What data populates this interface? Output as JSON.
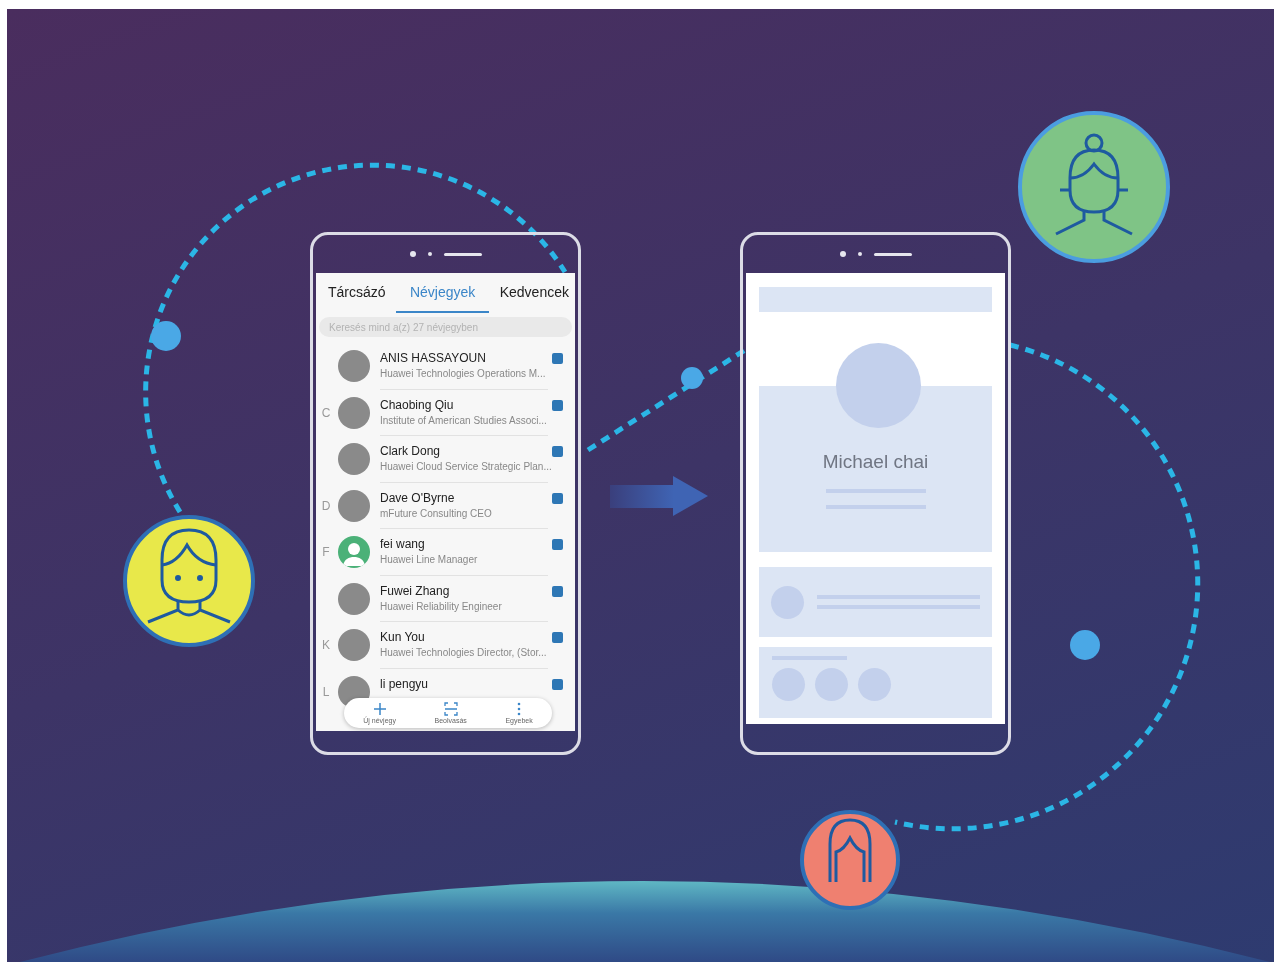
{
  "contacts_phone": {
    "tabs": [
      {
        "label": "Tárcsázó",
        "selected": false
      },
      {
        "label": "Névjegyek",
        "selected": true
      },
      {
        "label": "Kedvencek",
        "selected": false
      }
    ],
    "search": {
      "placeholder": "Keresés mind a(z) 27 névjegyben"
    },
    "contacts": [
      {
        "name": "ANIS HASSAYOUN",
        "subtitle": "Huawei Technologies Operations M...",
        "kind": "photo"
      },
      {
        "index_letter": "C",
        "name": "Chaobing Qiu",
        "subtitle": "Institute of American Studies Associ...",
        "kind": "photo"
      },
      {
        "name": "Clark Dong",
        "subtitle": "Huawei Cloud Service Strategic Plan...",
        "kind": "photo"
      },
      {
        "index_letter": "D",
        "name": "Dave O'Byrne",
        "subtitle": "mFuture Consulting CEO",
        "kind": "photo"
      },
      {
        "index_letter": "F",
        "name": "fei wang",
        "subtitle": "Huawei Line Manager",
        "kind": "silhouette"
      },
      {
        "name": "Fuwei Zhang",
        "subtitle": "Huawei Reliability Engineer",
        "kind": "photo"
      },
      {
        "index_letter": "K",
        "name": "Kun You",
        "subtitle": "Huawei Technologies Director, (Stor...",
        "kind": "photo"
      },
      {
        "index_letter": "L",
        "name": "li pengyu",
        "kind": "photo"
      }
    ],
    "bottom_bar": [
      {
        "kind": "plus",
        "label": "Új névjegy"
      },
      {
        "kind": "scan",
        "label": "Beolvasás"
      },
      {
        "kind": "more",
        "label": "Egyebek"
      }
    ]
  },
  "card_phone": {
    "name": "Michael chai"
  }
}
